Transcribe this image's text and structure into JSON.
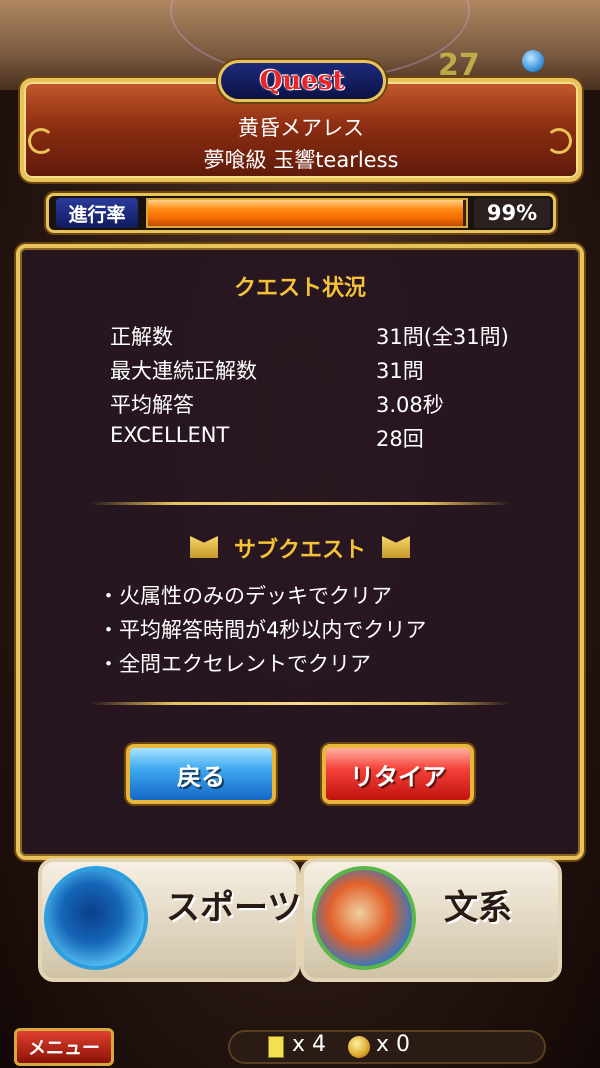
{
  "quest": {
    "tag": "Quest",
    "title": "黄昏メアレス",
    "subtitle": "夢喰級 玉響tearless"
  },
  "progress": {
    "label": "進行率",
    "percent_text": "99%",
    "value": 0.99
  },
  "status": {
    "heading": "クエスト状況",
    "rows": [
      {
        "label": "正解数",
        "value": "31問(全31問)"
      },
      {
        "label": "最大連続正解数",
        "value": "31問"
      },
      {
        "label": "平均解答",
        "value": "3.08秒"
      },
      {
        "label": "EXCELLENT",
        "value": "28回"
      }
    ]
  },
  "subquest": {
    "heading": "サブクエスト",
    "items": [
      "・火属性のみのデッキでクリア",
      "・平均解答時間が4秒以内でクリア",
      "・全問エクセレントでクリア"
    ]
  },
  "buttons": {
    "back": "戻る",
    "retire": "リタイア"
  },
  "genres": {
    "left": "スポーツ",
    "right": "文系"
  },
  "footer": {
    "menu": "メニュー",
    "card_count": "x 4",
    "coin_count": "x 0"
  },
  "background_counter": "27",
  "colors": {
    "gold_frame": "#e8c35a",
    "heading_gold": "#f3c236",
    "progress_orange": "#f26b00",
    "back_blue": "#3fa9f0",
    "retire_red": "#f5423a"
  }
}
